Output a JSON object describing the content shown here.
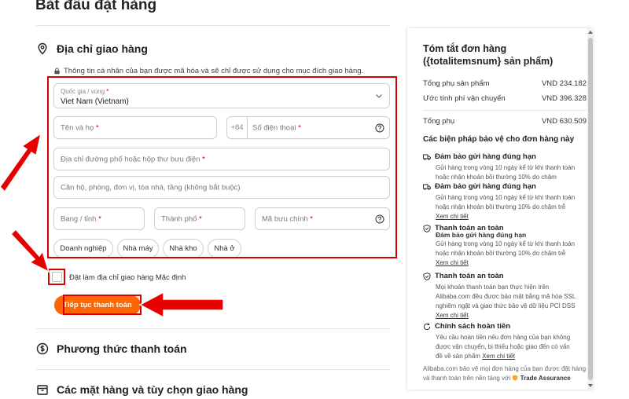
{
  "page": {
    "title": "Bắt đầu đặt hàng"
  },
  "shipping": {
    "heading": "Địa chỉ giao hàng",
    "privacy_note": "Thông tin cá nhân của bạn được mã hóa và sẽ chỉ được sử dụng cho mục đích giao hàng.",
    "country": {
      "label": "Quốc gia / vùng",
      "value": "Viet Nam (Vietnam)"
    },
    "name_placeholder": "Tên và họ",
    "phone_code": "+84",
    "phone_placeholder": "Số điện thoại",
    "street_placeholder": "Địa chỉ đường phố hoặc hộp thư bưu điện",
    "apt_placeholder": "Căn hộ, phòng, đơn vị, tòa nhà, tầng (không bắt buộc)",
    "state_placeholder": "Bang / tỉnh",
    "city_placeholder": "Thành phố",
    "zip_placeholder": "Mã bưu chính",
    "required_mark": "*",
    "address_types": [
      "Doanh nghiệp",
      "Nhà máy",
      "Nhà kho",
      "Nhà ở"
    ],
    "default_label": "Đặt làm địa chỉ giao hàng Mặc định",
    "continue_button": "Tiếp tục thanh toán"
  },
  "payment": {
    "heading": "Phương thức thanh toán"
  },
  "items": {
    "heading": "Các mặt hàng và tùy chọn giao hàng"
  },
  "summary": {
    "title": "Tóm tắt đơn hàng ({totalitemsnum} sản phẩm)",
    "subtotal_label": "Tổng phụ sản phẩm",
    "subtotal_value": "VND 234.182",
    "shipping_label": "Ước tính phí vận chuyển",
    "shipping_value": "VND 396.328",
    "total_label": "Tổng phụ",
    "total_value": "VND 630.509",
    "protection_title": "Các biện pháp bảo vệ cho đơn hàng này",
    "protections": [
      {
        "title": "Đảm bảo gửi hàng đúng hạn",
        "desc": "Gửi hàng trong vòng 10 ngày kể từ khi thanh toán hoặc nhận khoản bồi thường 10% do chậm"
      },
      {
        "title": "Đảm bảo gửi hàng đúng hạn",
        "desc": "Gửi hàng trong vòng 10 ngày kể từ khi thanh toán hoặc nhận khoản bồi thường 10% do chậm trễ",
        "link": "Xem chi tiết"
      },
      {
        "title": "Thanh toán an toàn",
        "overlap": "Đảm bảo gửi hàng đúng hạn",
        "desc": "Gửi hàng trong vòng 10 ngày kể từ khi thanh toán hoặc nhận khoản bồi thường 10% do chậm trễ",
        "link": "Xem chi tiết"
      },
      {
        "title": "Thanh toán an toàn",
        "desc": "Mọi khoản thanh toán bạn thực hiện trên Alibaba.com đều được bảo mật bằng mã hóa SSL nghiêm ngặt và giao thức bảo vệ dữ liệu PCI DSS",
        "link": "Xem chi tiết"
      },
      {
        "title": "Chính sách hoàn tiền",
        "desc": "Yêu cầu hoàn tiền nếu đơn hàng của bạn không được vận chuyển, bị thiếu hoặc giao đến có vấn đề về sản phẩm",
        "link": "Xem chi tiết"
      }
    ],
    "footer": "Alibaba.com bảo vệ mọi đơn hàng của bạn được đặt hàng và thanh toán trên nền tảng với",
    "footer_badge": "Trade Assurance"
  },
  "colors": {
    "accent": "#ff6600",
    "annotation_red": "#d90000"
  }
}
